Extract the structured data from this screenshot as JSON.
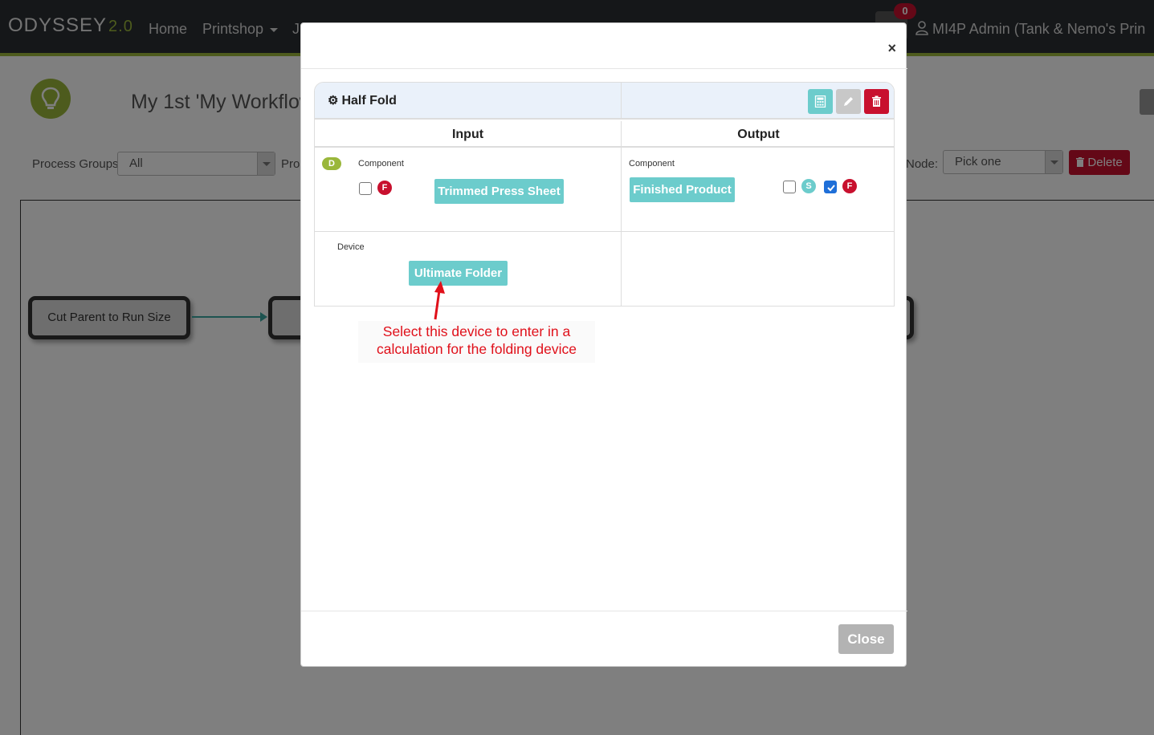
{
  "navbar": {
    "brand": "ODYSSEY",
    "version": "2.0",
    "links": [
      "Home",
      "Printshop",
      "J"
    ],
    "notification_count": "0",
    "user_label": "MI4P Admin (Tank & Nemo's Prin"
  },
  "page": {
    "title": "My 1st 'My Workflow",
    "filters": {
      "process_groups_label": "Process Groups",
      "process_groups_value": "All",
      "process_label_partial": "Pro",
      "node_label": "Node:",
      "node_value": "Pick one",
      "delete_label": "Delete"
    }
  },
  "workflow": {
    "nodes": [
      "Cut Parent to Run Size"
    ]
  },
  "modal": {
    "process_name": "Half Fold",
    "input_header": "Input",
    "output_header": "Output",
    "input": {
      "badge": "D",
      "component_label": "Component",
      "component_flag": "F",
      "component_name": "Trimmed Press Sheet",
      "device_label": "Device",
      "device_name": "Ultimate Folder"
    },
    "output": {
      "component_label": "Component",
      "component_name": "Finished Product",
      "flag_s": "S",
      "flag_f": "F",
      "checkbox_s_checked": false,
      "checkbox_f_checked": true
    },
    "close_label": "Close",
    "close_x": "×"
  },
  "annotation": {
    "line1": "Select this device to enter in a",
    "line2": "calculation for the folding device"
  },
  "colors": {
    "teal": "#6ccccc",
    "danger": "#c8102e",
    "brand_green": "#9ab73b",
    "annotation_red": "#e0101a"
  }
}
